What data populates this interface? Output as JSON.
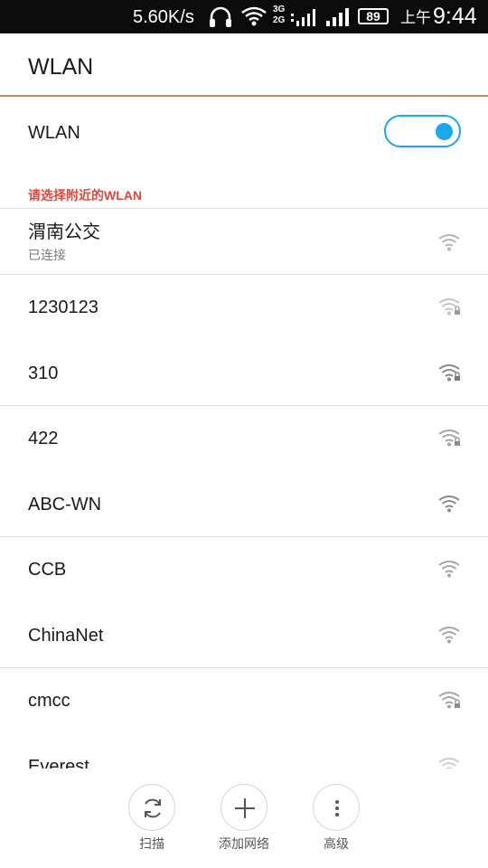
{
  "status_bar": {
    "speed": "5.60K/s",
    "net_top": "3G",
    "net_bottom": "2G",
    "battery": "89",
    "ampm": "上午",
    "time": "9:44"
  },
  "header": {
    "title": "WLAN"
  },
  "wlan_toggle": {
    "label": "WLAN",
    "on": true
  },
  "section_header": "请选择附近的WLAN",
  "networks": [
    {
      "name": "渭南公交",
      "status": "已连接",
      "secured": false
    },
    {
      "name": "1230123",
      "secured": true
    },
    {
      "name": "310",
      "secured": true
    },
    {
      "name": "422",
      "secured": true
    },
    {
      "name": "ABC-WN",
      "secured": false
    },
    {
      "name": "CCB",
      "secured": false
    },
    {
      "name": "ChinaNet",
      "secured": false
    },
    {
      "name": "cmcc",
      "secured": true
    },
    {
      "name": "Everest",
      "secured": false
    }
  ],
  "bottom_actions": [
    {
      "label": "扫描",
      "icon": "refresh-icon"
    },
    {
      "label": "添加网络",
      "icon": "plus-icon"
    },
    {
      "label": "高级",
      "icon": "more-vertical-icon"
    }
  ],
  "colors": {
    "accent": "#1aa7ec",
    "section_header": "#e0473c",
    "title_underline": "#c98a74"
  }
}
